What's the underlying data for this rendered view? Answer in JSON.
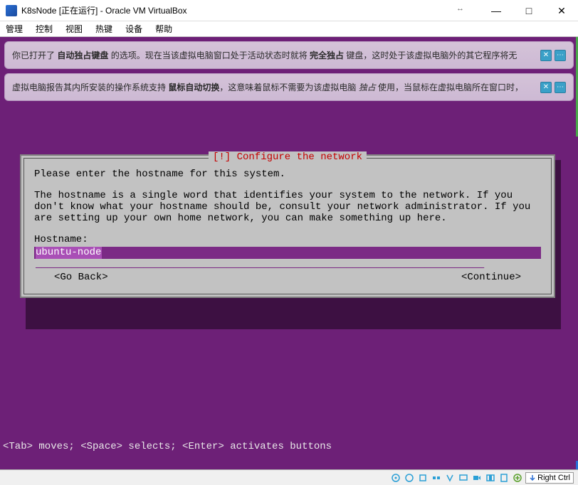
{
  "titlebar": {
    "title": "K8sNode [正在运行] - Oracle VM VirtualBox",
    "resize_icon": "↔",
    "minimize": "—",
    "maximize": "□",
    "close": "✕"
  },
  "menubar": {
    "items": [
      "管理",
      "控制",
      "视图",
      "热键",
      "设备",
      "帮助"
    ]
  },
  "banners": [
    {
      "prefix": "你已打开了 ",
      "bold1": "自动独占键盘",
      "mid": " 的选项。现在当该虚拟电脑窗口处于活动状态时就将 ",
      "bold2": "完全独占",
      "suffix": " 键盘，这时处于该虚拟电脑外的其它程序将无"
    },
    {
      "prefix": "虚拟电脑报告其内所安装的操作系统支持 ",
      "bold1": "鼠标自动切换",
      "mid": "，这意味着鼠标不需要为该虚拟电脑 ",
      "italic": "独占",
      "suffix": " 使用，当鼠标在虚拟电脑所在窗口时，"
    }
  ],
  "installer": {
    "title": "[!] Configure the network",
    "para1": "Please enter the hostname for this system.",
    "para2": "The hostname is a single word that identifies your system to the network. If you don't know what your hostname should be, consult your network administrator. If you are setting up your own home network, you can make something up here.",
    "hostname_label": "Hostname:",
    "hostname_value": "ubuntu-node",
    "go_back": "<Go Back>",
    "continue": "<Continue>"
  },
  "bottom_help": "<Tab> moves; <Space> selects; <Enter> activates buttons",
  "statusbar": {
    "hostkey": "Right Ctrl"
  }
}
